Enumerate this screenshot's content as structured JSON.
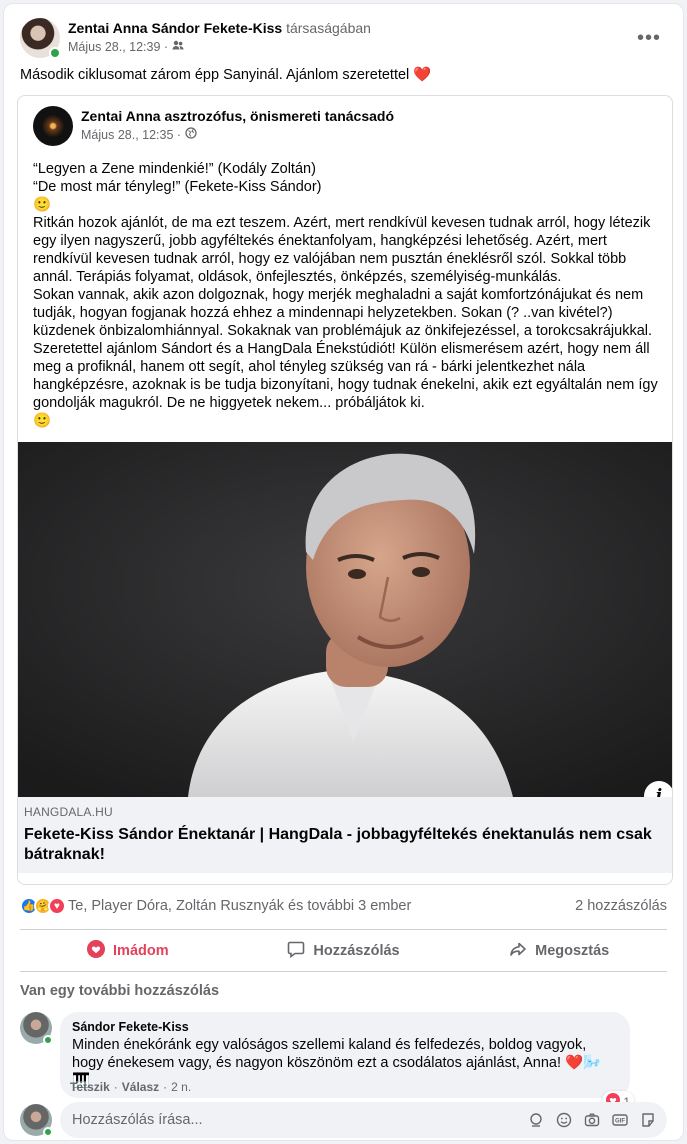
{
  "post": {
    "author": "Zentai Anna Sándor Fekete-Kiss",
    "with_text": "társaságában",
    "timestamp": "Május 28., 12:39 ·",
    "text": "Második ciklusomat zárom épp Sanyinál. Ajánlom szeretettel ❤️"
  },
  "shared": {
    "author": "Zentai Anna asztrozófus, önismereti tanácsadó",
    "timestamp": "Május 28., 12:35 ·",
    "paragraphs": [
      "“Legyen a Zene mindenkié!” (Kodály Zoltán)",
      "“De most már tényleg!” (Fekete-Kiss Sándor)",
      "🙂",
      "Ritkán hozok ajánlót, de ma ezt teszem. Azért, mert rendkívül kevesen tudnak arról, hogy létezik egy ilyen nagyszerű, jobb agyféltekés énektanfolyam, hangképzési lehetőség. Azért, mert rendkívül kevesen tudnak arról, hogy ez valójában nem pusztán éneklésről szól. Sokkal több annál. Terápiás folyamat, oldások, önfejlesztés, önképzés, személyiség-munkálás.",
      "Sokan vannak, akik azon dolgoznak, hogy merjék meghaladni a saját komfortzónájukat és nem tudják, hogyan fogjanak hozzá ehhez a mindennapi helyzetekben. Sokan (? ..van kivétel?) küzdenek önbizalomhiánnyal. Sokaknak van problémájuk az önkifejezéssel, a torokcsakrájukkal.",
      "Szeretettel ajánlom Sándort és a HangDala Énekstúdiót! Külön elismerésem azért, hogy nem áll meg a profiknál, hanem ott segít, ahol tényleg szükség van rá - bárki jelentkezhet nála hangképzésre, azoknak is be tudja bizonyítani, hogy tudnak énekelni, akik ezt egyáltalán nem így gondolják magukról. De ne higgyetek nekem... próbáljátok ki.",
      "🙂"
    ],
    "link_domain": "HANGDALA.HU",
    "link_title": "Fekete-Kiss Sándor Énektanár | HangDala - jobbagyféltekés énektanulás nem csak bátraknak!"
  },
  "reactions": {
    "names": "Te, Plаyer Dóra, Zoltán Rusznyák és további 3 ember",
    "comments_count": "2 hozzászólás"
  },
  "actions": {
    "love": "Imádom",
    "comment": "Hozzászólás",
    "share": "Megosztás"
  },
  "more_comments": "Van egy további hozzászólás",
  "comment": {
    "author": "Sándor Fekete-Kiss",
    "text": "Minden énekóránk egy valóságos szellemi kaland és felfedezés, boldog vagyok, hogy énekesem vagy, és nagyon köszönöm ezt a csodálatos ajánlást, Anna! ❤️🌬️🎹",
    "reaction_count": "1",
    "like": "Tetszik",
    "reply": "Válasz",
    "age": "2 n."
  },
  "composer": {
    "placeholder": "Hozzászólás írása..."
  },
  "colors": {
    "love": "#e4415a",
    "online": "#31a24c",
    "secondary_text": "#65676b"
  }
}
